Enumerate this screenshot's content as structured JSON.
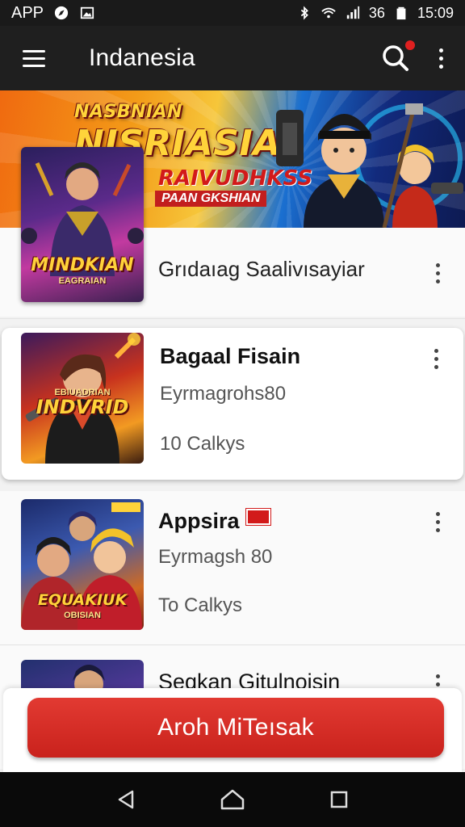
{
  "status_bar": {
    "left_text": "APP",
    "time": "15:09",
    "carrier": "36"
  },
  "app_bar": {
    "title": "Indanesia",
    "icons": [
      "menu-icon",
      "search-icon",
      "more-vert-icon"
    ]
  },
  "banner": {
    "title_small": "NASBNIAN",
    "title_big": "NISRIASIA",
    "tag1": "RAIVUDHKSS",
    "tag2": "PAAN GKSHIAN"
  },
  "items": [
    {
      "title": "Grıdaıag Saalivısayiar",
      "thumb_label": "MINDKIAN",
      "thumb_sub": "EAGRAIAN"
    },
    {
      "title": "Bagaal Fisain",
      "subtitle": "Eyrmagrohs80",
      "meta": "10 Calkys",
      "thumb_label": "INDVRID",
      "thumb_sub": "EBIUADRIAN"
    },
    {
      "title": "Appsira",
      "subtitle": "Eyrmagsh 80",
      "meta": "To Calkys",
      "thumb_label": "EQUAKIUK",
      "thumb_sub": "OBISIAN"
    },
    {
      "title": "Seqkan Gitulnoisin"
    }
  ],
  "action": {
    "label": "Aroh MiTeısak"
  },
  "colors": {
    "accent": "#d4261f",
    "app_bar": "#1f1f1f",
    "status_bar": "#1a1a1a"
  }
}
